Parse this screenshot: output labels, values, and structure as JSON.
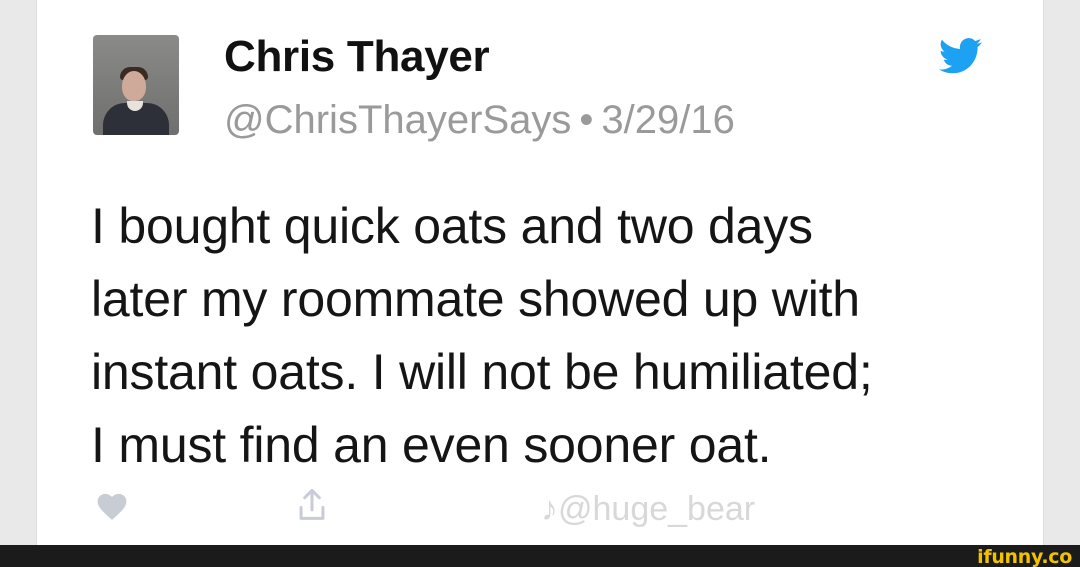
{
  "tweet": {
    "display_name": "Chris Thayer",
    "handle": "@ChrisThayerSays",
    "separator": "•",
    "date": "3/29/16",
    "text_lines": [
      "I bought quick oats and two days",
      "later my roommate showed up with",
      "instant oats. I will not be humiliated;",
      "I must find an even sooner oat."
    ]
  },
  "watermark": {
    "text": "♪@huge_bear"
  },
  "footer": {
    "brand": "ifunny.co"
  },
  "colors": {
    "twitter_blue": "#1da1f2",
    "ifunny_yellow": "#f2c200",
    "meta_gray": "#9a9a9a"
  },
  "icons": {
    "bird": "twitter-bird-icon",
    "like": "heart-icon",
    "share": "share-icon"
  }
}
